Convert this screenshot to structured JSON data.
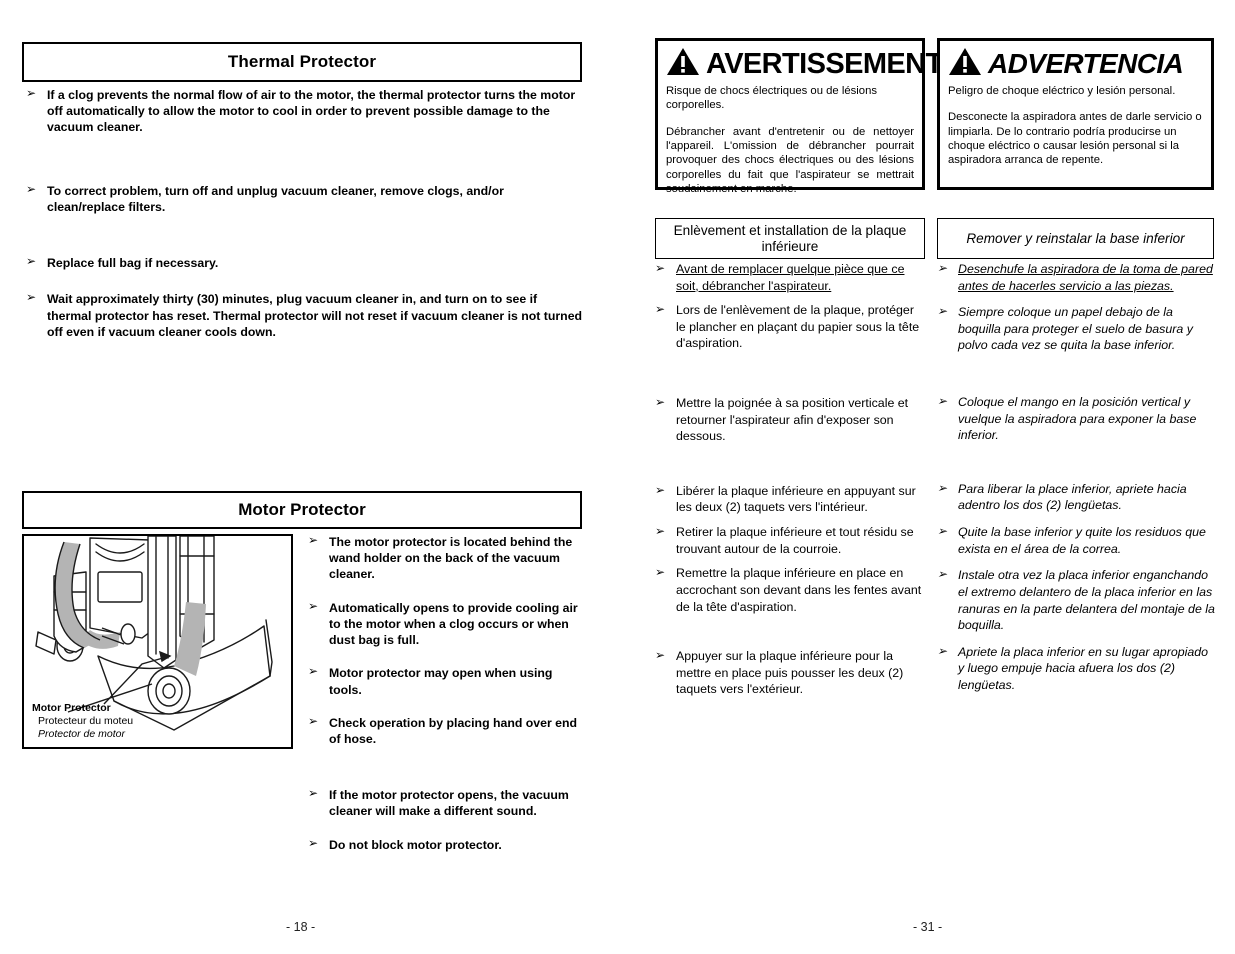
{
  "english_column": {
    "thermal_protector": {
      "title": "Thermal Protector",
      "bullets": [
        "If a clog prevents the normal flow of air to the motor, the thermal protector turns the motor off automatically to allow the motor to cool in order to prevent possible damage to the vacuum cleaner.",
        "To correct problem, turn off and unplug vacuum cleaner, remove clogs, and/or clean/replace filters.",
        "Replace full bag if necessary.",
        "Wait approximately thirty (30) minutes, plug vacuum cleaner in, and turn on to see if thermal protector has reset. Thermal protector will not reset if vacuum cleaner is not turned off even if vacuum cleaner cools down."
      ]
    },
    "motor_protector": {
      "title": "Motor Protector",
      "bullets": [
        "The motor protector is located behind the wand holder on the back of the vacuum cleaner.",
        "Automatically opens to provide cooling air to the motor when a clog occurs or when dust bag is full.",
        "Motor protector may open when using tools.",
        "Check operation by placing hand over end of hose.",
        "If the motor protector opens, the vacuum cleaner will make a different sound.",
        "Do not block motor protector."
      ],
      "figure": {
        "caption_en": "Motor Protector",
        "caption_fr": "Protecteur du moteu",
        "caption_es": "Protector de motor"
      }
    },
    "page_number": "- 18 -"
  },
  "french_column": {
    "warning": {
      "heading": "AVERTISSEMENT",
      "icon": "warning-triangle-icon",
      "paragraphs": [
        "Risque de chocs électriques ou de lésions corporelles.",
        "Débrancher avant d'entretenir ou de nettoyer l'appareil. L'omission de débrancher pourrait provoquer des chocs électriques ou des lésions corporelles du fait que l'aspirateur se mettrait soudainement en marche."
      ]
    },
    "section_title": "Enlèvement et installation de la plaque inférieure",
    "bullets": [
      {
        "text": "Avant de remplacer quelque pièce que ce soit, débrancher l'aspirateur.",
        "underline": true
      },
      {
        "text": "Lors de l'enlèvement de la plaque, protéger le plancher en plaçant du papier sous la tête d'aspiration.",
        "underline": false
      },
      {
        "text": "Mettre la poignée à sa position verticale et retourner l'aspirateur afin d'exposer son dessous.",
        "underline": false
      },
      {
        "text": "Libérer la plaque inférieure en appuyant sur les deux (2) taquets vers l'intérieur.",
        "underline": false
      },
      {
        "text": "Retirer la plaque inférieure et tout résidu se trouvant autour de la courroie.",
        "underline": false
      },
      {
        "text": "Remettre la plaque inférieure en place en accrochant son devant dans les fentes avant de la tête d'aspiration.",
        "underline": false
      },
      {
        "text": "Appuyer sur la plaque inférieure pour la mettre en place puis pousser les deux (2) taquets vers l'extérieur.",
        "underline": false
      }
    ]
  },
  "spanish_column": {
    "warning": {
      "heading": "ADVERTENCIA",
      "icon": "warning-triangle-icon",
      "paragraphs": [
        "Peligro de choque eléctrico y lesión personal.",
        "Desconecte la aspiradora antes de darle servicio o limpiarla.  De lo contrario podría producirse un choque eléctrico o causar lesión personal si la aspiradora arranca de repente."
      ]
    },
    "section_title": "Remover y reinstalar la base inferior",
    "bullets": [
      {
        "text": "Desenchufe la aspiradora de la toma de pared antes de hacerles servicio a las piezas.",
        "underline": true
      },
      {
        "text": "Siempre coloque un papel debajo de la boquilla para proteger el suelo de basura y polvo cada vez se quita la base inferior.",
        "underline": false
      },
      {
        "text": "Coloque el mango en la posición vertical y vuelque la aspiradora para exponer la base inferior.",
        "underline": false
      },
      {
        "text": "Para liberar la place inferior, apriete hacia adentro los dos (2) lengüetas.",
        "underline": false
      },
      {
        "text": "Quite la base inferior y quite los residuos que exista en el área de la correa.",
        "underline": false
      },
      {
        "text": "Instale otra vez la placa inferior enganchando el extremo delantero de la placa inferior en las ranuras en la parte delantera del montaje de la boquilla.",
        "underline": false
      },
      {
        "text": "Apriete la placa inferior en su lugar apropiado y luego empuje hacia afuera los dos (2) lengüetas.",
        "underline": false
      }
    ],
    "page_number": "- 31 -"
  },
  "bullet_glyph": "➢",
  "colors": {
    "text": "#000000",
    "rule": "#000000",
    "page_background": "#ffffff"
  }
}
